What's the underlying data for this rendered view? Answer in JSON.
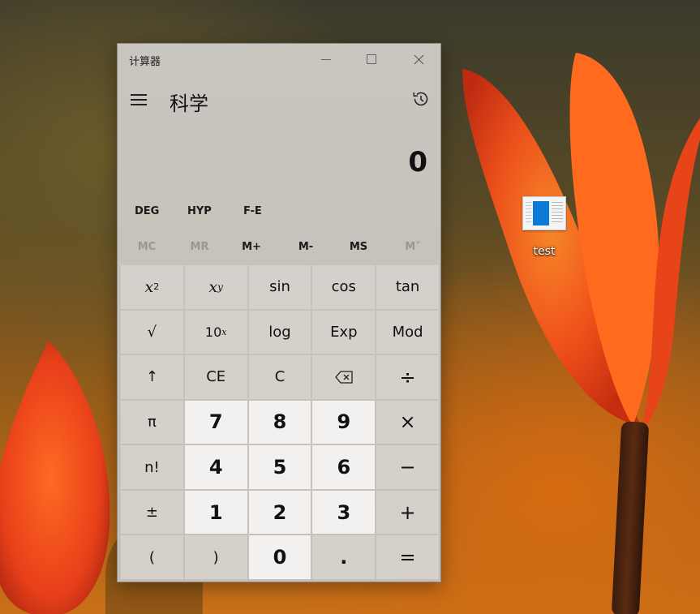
{
  "desktop": {
    "icon_label": "test"
  },
  "window": {
    "title": "计算器",
    "mode": "科学"
  },
  "display": {
    "value": "0"
  },
  "mode_buttons": [
    "DEG",
    "HYP",
    "F-E"
  ],
  "memory_buttons": [
    {
      "label": "MC",
      "enabled": false
    },
    {
      "label": "MR",
      "enabled": false
    },
    {
      "label": "M+",
      "enabled": true
    },
    {
      "label": "M-",
      "enabled": true
    },
    {
      "label": "MS",
      "enabled": true
    },
    {
      "label": "M˅",
      "enabled": false
    }
  ],
  "keys": {
    "r1": [
      "x²",
      "xʸ",
      "sin",
      "cos",
      "tan"
    ],
    "r2": [
      "√",
      "10ˣ",
      "log",
      "Exp",
      "Mod"
    ],
    "r3": [
      "↑",
      "CE",
      "C",
      "backspace",
      "÷"
    ],
    "r4": [
      "π",
      "7",
      "8",
      "9",
      "×"
    ],
    "r5": [
      "n!",
      "4",
      "5",
      "6",
      "−"
    ],
    "r6": [
      "±",
      "1",
      "2",
      "3",
      "+"
    ],
    "r7": [
      "(",
      ")",
      "0",
      ".",
      "="
    ]
  },
  "labels": {
    "sin": "sin",
    "cos": "cos",
    "tan": "tan",
    "log": "log",
    "exp": "Exp",
    "mod": "Mod",
    "sqrt": "√",
    "up": "↑",
    "ce": "CE",
    "c": "C",
    "div": "÷",
    "pi": "π",
    "fact": "n!",
    "neg": "±",
    "mul": "×",
    "sub": "−",
    "add": "+",
    "eq": "=",
    "lparen": "(",
    "rparen": ")",
    "dot": ".",
    "n0": "0",
    "n1": "1",
    "n2": "2",
    "n3": "3",
    "n4": "4",
    "n5": "5",
    "n6": "6",
    "n7": "7",
    "n8": "8",
    "n9": "9",
    "x": "x",
    "sq_exp": "2",
    "y_exp": "y",
    "ten": "10",
    "ten_exp": "x"
  },
  "colors": {
    "window_bg": "#c7c3bc",
    "number_key_bg": "#f2f1ef",
    "disabled_text": "#9a9792",
    "icon_blue": "#0d7ad8"
  },
  "icons": [
    "hamburger-icon",
    "history-icon",
    "backspace-icon",
    "minimize-icon",
    "maximize-icon",
    "close-icon",
    "document-icon"
  ]
}
